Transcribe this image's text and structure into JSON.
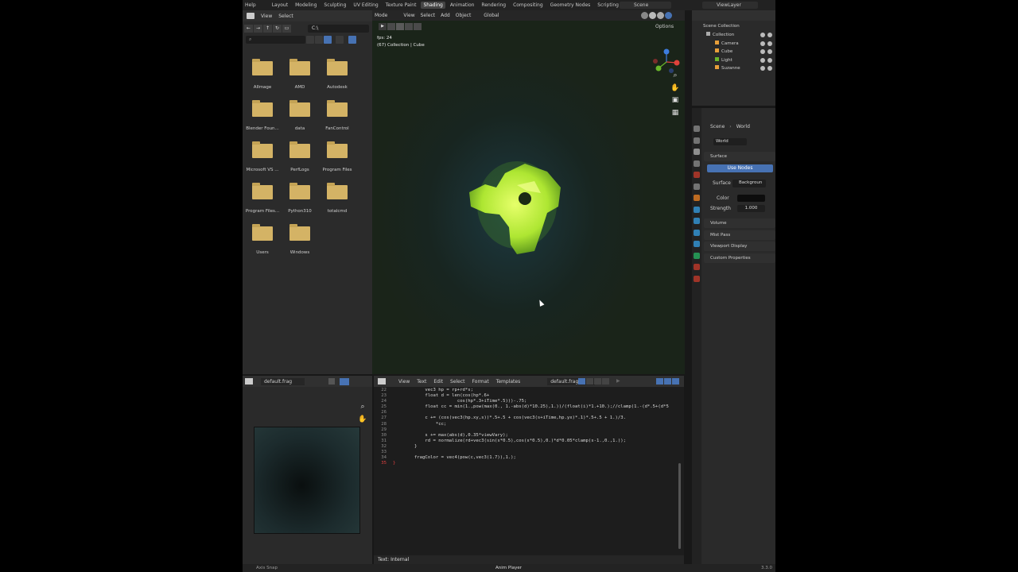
{
  "menu": {
    "help": "Help"
  },
  "workspaces": [
    "Layout",
    "Modeling",
    "Sculpting",
    "UV Editing",
    "Texture Paint",
    "Shading",
    "Animation",
    "Rendering",
    "Compositing",
    "Geometry Nodes",
    "Scripting",
    "+"
  ],
  "active_workspace_index": 5,
  "scene_name": "Scene",
  "view_layer": "ViewLayer",
  "file_browser": {
    "menus": [
      "View",
      "Select"
    ],
    "path": "C:\\",
    "items": [
      "AIImage",
      "AMD",
      "Autodesk",
      "Blender Foun...",
      "data",
      "FanControl",
      "Microsoft VS ...",
      "PerfLogs",
      "Program Files",
      "Program Files...",
      "Python310",
      "totalcmd",
      "Users",
      "Windows"
    ]
  },
  "viewport": {
    "menus": [
      "Mode",
      "View",
      "Select",
      "Add",
      "Object"
    ],
    "transform": "Global",
    "options": "Options",
    "fps": "fps: 24",
    "collection_label": "(67) Collection | Cube"
  },
  "outliner": {
    "title": "Scene Collection",
    "rows": [
      "Collection",
      "Camera",
      "Cube",
      "Light",
      "Suzanne"
    ]
  },
  "properties": {
    "breadcrumb_scene": "Scene",
    "breadcrumb_world": "World",
    "world_name": "World",
    "surface_section": "Surface",
    "use_nodes": "Use Nodes",
    "surface_label": "Surface",
    "surface_value": "Backgroun",
    "color_label": "Color",
    "strength_label": "Strength",
    "strength_value": "1.000",
    "sections": [
      "Volume",
      "Mist Pass",
      "Viewport Display",
      "Custom Properties"
    ]
  },
  "image_editor": {
    "image_name": "default.frag"
  },
  "text_editor": {
    "menus": [
      "View",
      "Text",
      "Edit",
      "Select",
      "Format",
      "Templates"
    ],
    "file_name": "default.frag",
    "footer": "Text: Internal",
    "lines": [
      {
        "n": "22",
        "t": "            vec3 hp = rp+rd*s;"
      },
      {
        "n": "23",
        "t": "            float d = len(cos(hp*.6+"
      },
      {
        "n": "24",
        "t": "                        cos(hp*.3+iTime*.5)))-.75;"
      },
      {
        "n": "25",
        "t": "            float cc = min(1.,pow(max(0., 1.-abs(d)*10.25),1.))/(float(i)*1.+10.);//clamp(1.-(d*.5+(d*5"
      },
      {
        "n": "26",
        "t": ""
      },
      {
        "n": "27",
        "t": "            c += (cos(vec3(hp.xy,s))*.5+.5 + cos(vec3(s+iTime,hp.yx)*.1)*.5+.5 + 1.)/3."
      },
      {
        "n": "28",
        "t": "                *cc;"
      },
      {
        "n": "29",
        "t": ""
      },
      {
        "n": "30",
        "t": "            s += max(abs(d),0.35*viewVary);"
      },
      {
        "n": "31",
        "t": "            rd = normalize(rd+vec3(sin(s*0.5),cos(s*0.5),0.)*d*0.05*clamp(s-1.,0.,1.));"
      },
      {
        "n": "32",
        "t": "        }"
      },
      {
        "n": "33",
        "t": ""
      },
      {
        "n": "34",
        "t": "        fragColor = vec4(pow(c,vec3(1.7)),1.);"
      },
      {
        "n": "35",
        "t": "}"
      }
    ]
  },
  "status_bar": {
    "left": "Axis Snap",
    "center": "Anim Player",
    "version": "3.3.0"
  },
  "colors": {
    "accent": "#4772b3",
    "folder": "#d4b365",
    "monkey_glow": "#c8f542"
  }
}
